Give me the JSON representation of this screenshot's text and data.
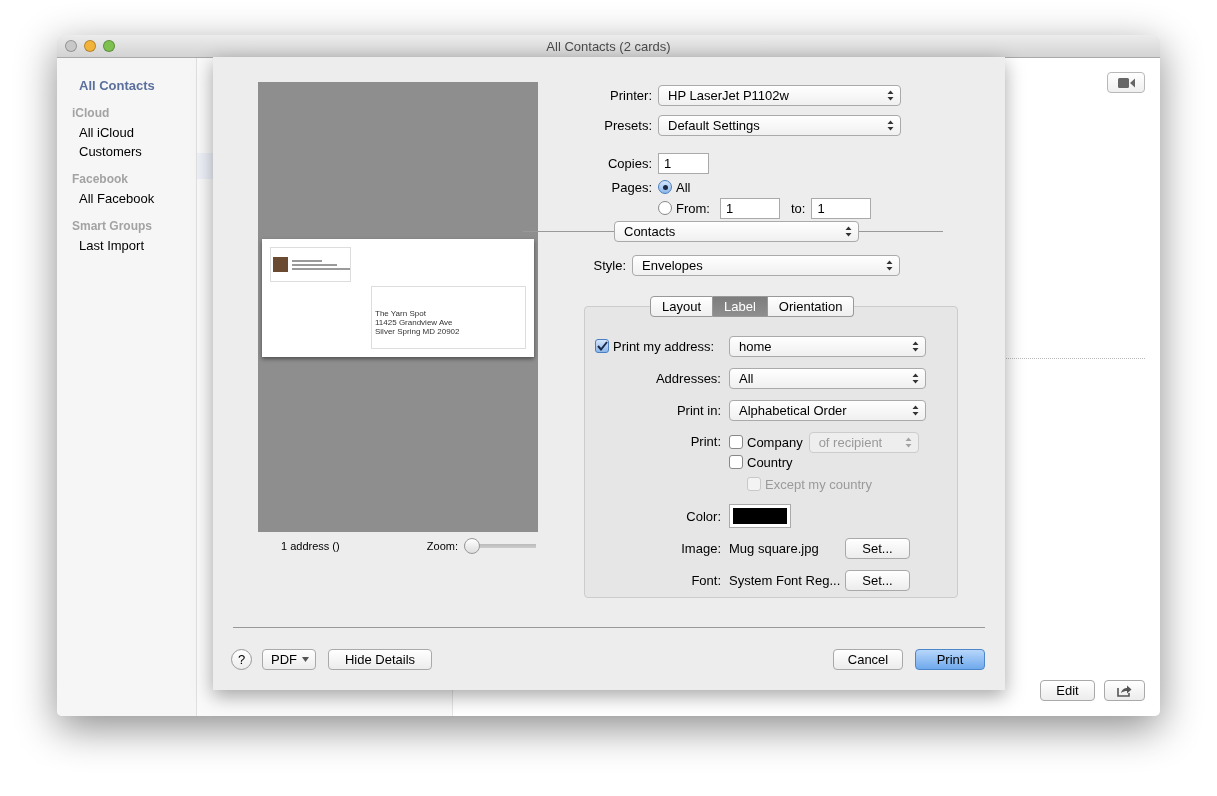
{
  "window": {
    "title": "All Contacts (2 cards)"
  },
  "sidebar": {
    "sections": [
      {
        "items": [
          {
            "label": "All Contacts",
            "selected": true
          }
        ]
      },
      {
        "header": "iCloud",
        "items": [
          {
            "label": "All iCloud",
            "selected": false
          },
          {
            "label": "Customers",
            "selected": false
          }
        ]
      },
      {
        "header": "Facebook",
        "items": [
          {
            "label": "All Facebook",
            "selected": false
          }
        ]
      },
      {
        "header": "Smart Groups",
        "items": [
          {
            "label": "Last Import",
            "selected": false
          }
        ]
      }
    ]
  },
  "detail": {
    "edit_button": "Edit"
  },
  "print_sheet": {
    "preview": {
      "recipient_lines": [
        "The Yarn Spot",
        "11425 Grandview Ave",
        "Silver Spring MD 20902"
      ],
      "count": "1 address  ()",
      "zoom_label": "Zoom:",
      "zoom": {
        "level": 0
      }
    },
    "printer": {
      "label": "Printer:",
      "value": "HP LaserJet P1102w"
    },
    "presets": {
      "label": "Presets:",
      "value": "Default Settings"
    },
    "copies": {
      "label": "Copies:",
      "value": "1"
    },
    "pages": {
      "label": "Pages:",
      "options": [
        {
          "label": "All",
          "selected": true
        },
        {
          "label": "From:",
          "selected": false
        }
      ],
      "from": "1",
      "to_label": "to:",
      "to": "1"
    },
    "app_menu": "Contacts",
    "style": {
      "label": "Style:",
      "value": "Envelopes"
    },
    "tabs": [
      {
        "label": "Layout",
        "selected": false
      },
      {
        "label": "Label",
        "selected": true
      },
      {
        "label": "Orientation",
        "selected": false
      }
    ],
    "print_my_address": {
      "label": "Print my address:",
      "checked": true,
      "value": "home"
    },
    "addresses": {
      "label": "Addresses:",
      "value": "All"
    },
    "print_in": {
      "label": "Print in:",
      "value": "Alphabetical Order"
    },
    "print": {
      "label": "Print:",
      "options": [
        {
          "label": "Company",
          "checked": false,
          "popup": "of recipient"
        },
        {
          "label": "Country",
          "checked": false,
          "children": [
            {
              "label": "Except my country",
              "checked": false,
              "disabled": true
            }
          ]
        }
      ]
    },
    "color": {
      "label": "Color:",
      "color": "#000000"
    },
    "image": {
      "label": "Image:",
      "value": "Mug square.jpg",
      "button": "Set..."
    },
    "font": {
      "label": "Font:",
      "value": "System Font Reg...",
      "button": "Set..."
    },
    "footer": {
      "help": "?",
      "pdf": "PDF",
      "hide_details": "Hide Details",
      "cancel": "Cancel",
      "print": "Print"
    }
  }
}
